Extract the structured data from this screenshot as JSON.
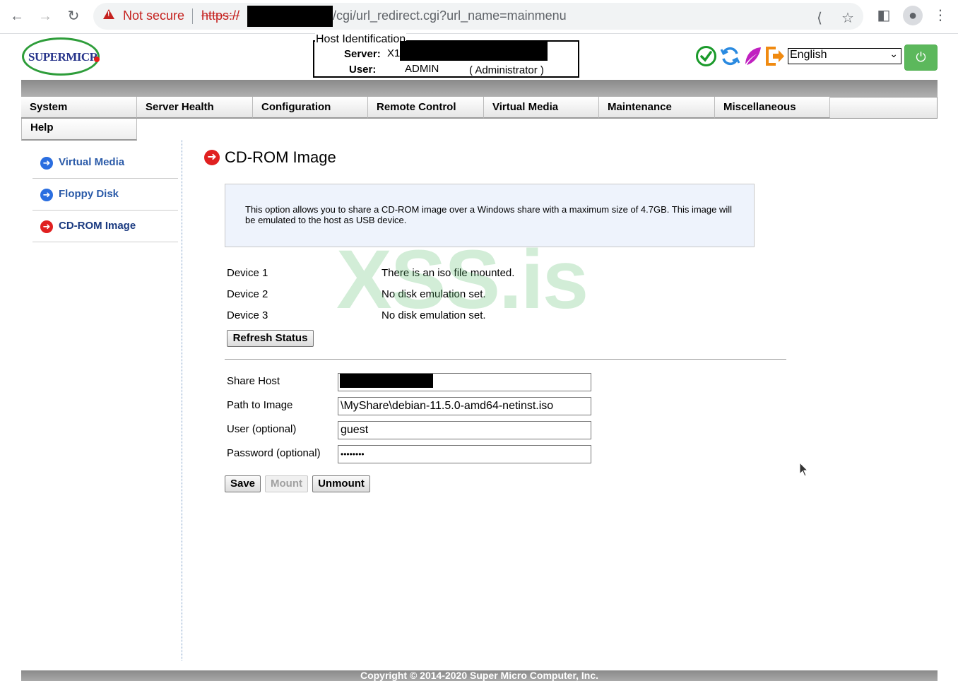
{
  "browser": {
    "security_label": "Not secure",
    "protocol": "https://",
    "url_path": "/cgi/url_redirect.cgi?url_name=mainmenu"
  },
  "header": {
    "logo_text": "SUPERMICR",
    "host_title": "Host Identification",
    "server_label": "Server:",
    "server_value": "X1",
    "server_suffix": ")",
    "user_label": "User:",
    "user_value": "ADMIN",
    "user_role": "( Administrator )",
    "language": "English"
  },
  "nav": {
    "items": [
      "System",
      "Server Health",
      "Configuration",
      "Remote Control",
      "Virtual Media",
      "Maintenance",
      "Miscellaneous"
    ],
    "help": "Help"
  },
  "sidebar": {
    "items": [
      "Virtual Media",
      "Floppy Disk",
      "CD-ROM Image"
    ]
  },
  "main": {
    "title": "CD-ROM Image",
    "info": "This option allows you to share a CD-ROM image over a Windows share with a maximum size of 4.7GB. This image will be emulated to the host as USB device.",
    "devices": [
      {
        "label": "Device 1",
        "status": "There is an iso file mounted."
      },
      {
        "label": "Device 2",
        "status": "No disk emulation set."
      },
      {
        "label": "Device 3",
        "status": "No disk emulation set."
      }
    ],
    "refresh_label": "Refresh Status",
    "form": {
      "share_host_label": "Share Host",
      "share_host_value": "",
      "path_label": "Path to Image",
      "path_value": "\\MyShare\\debian-11.5.0-amd64-netinst.iso",
      "user_label": "User (optional)",
      "user_value": "guest",
      "password_label": "Password (optional)",
      "password_value": "••••••••"
    },
    "save_label": "Save",
    "mount_label": "Mount",
    "unmount_label": "Unmount"
  },
  "watermark": "XSS.is",
  "footer": "Copyright © 2014-2020 Super Micro Computer, Inc."
}
